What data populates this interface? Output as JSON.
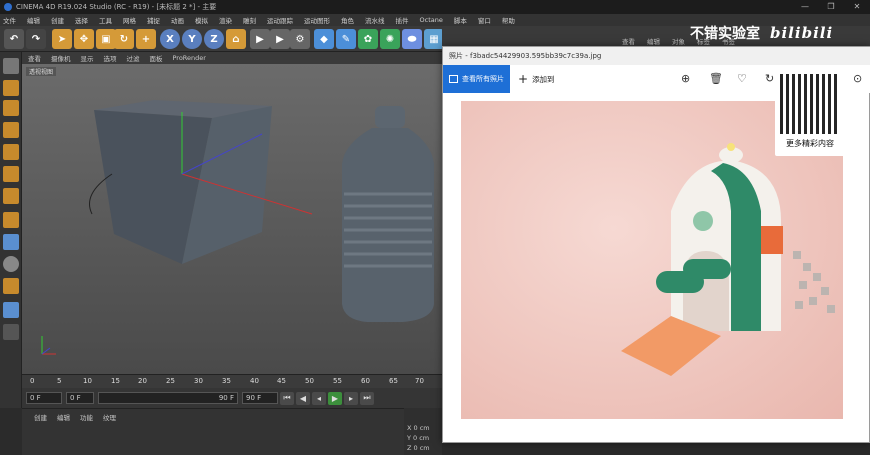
{
  "app": {
    "title": "CINEMA 4D R19.024 Studio (RC - R19) - [未标题 2 *] - 主要",
    "win_controls": [
      "—",
      "❐",
      "✕"
    ]
  },
  "menu": [
    "文件",
    "编辑",
    "创建",
    "选择",
    "工具",
    "网格",
    "捕捉",
    "动画",
    "模拟",
    "渲染",
    "雕刻",
    "运动跟踪",
    "运动图形",
    "角色",
    "流水线",
    "插件",
    "Octane",
    "脚本",
    "窗口",
    "帮助"
  ],
  "toolbar": {
    "x": "X",
    "y": "Y",
    "z": "Z"
  },
  "viewport": {
    "menu": [
      "查看",
      "摄像机",
      "显示",
      "选项",
      "过滤",
      "面板",
      "ProRender"
    ],
    "label": "透视视图"
  },
  "timeline": {
    "ticks": [
      "0",
      "5",
      "10",
      "15",
      "20",
      "25",
      "30",
      "35",
      "40",
      "45",
      "50",
      "55",
      "60",
      "65",
      "70"
    ]
  },
  "transport": {
    "start": "0 F",
    "current": "0 F",
    "end": "90 F",
    "end2": "90 F"
  },
  "bottom": {
    "menu": [
      "创建",
      "编辑",
      "功能",
      "纹理"
    ],
    "coords": [
      "X 0 cm",
      "Y 0 cm",
      "Z 0 cm"
    ]
  },
  "right_menu": [
    "查看",
    "编辑",
    "对象",
    "标签",
    "书签"
  ],
  "photos": {
    "title": "照片 - f3badc54429903.595bb39c7c39a.jpg",
    "view_all": "查看所有照片",
    "add_to": "添加到",
    "icons": [
      "zoom-icon",
      "delete-icon",
      "heart-icon",
      "rotate-icon",
      "crop-icon",
      "more-icon"
    ]
  },
  "watermark": {
    "text": "不错实验室",
    "logo": "bilibili",
    "qr_caption": "更多精彩内容"
  }
}
